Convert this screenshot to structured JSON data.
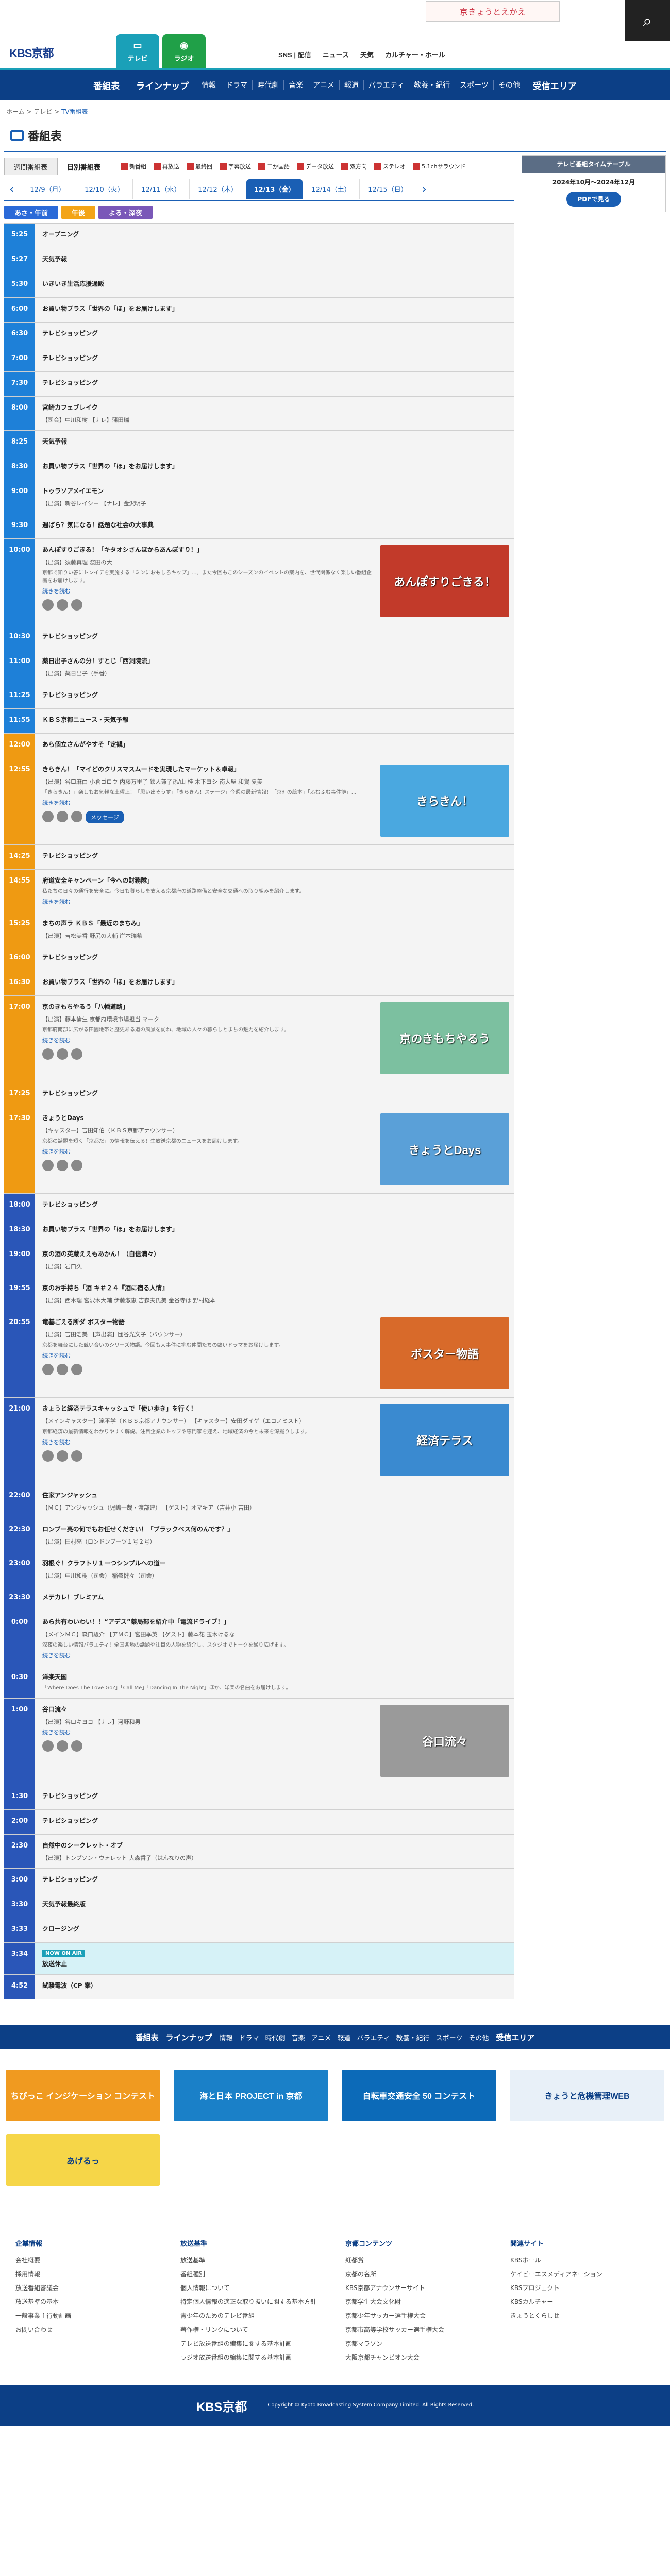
{
  "header": {
    "logo": "KBS京都",
    "media_tabs": [
      {
        "label": "テレビ"
      },
      {
        "label": "ラジオ"
      }
    ],
    "top_links": [
      "SNS | 配信",
      "ニュース",
      "天気",
      "カルチャー・ホール"
    ],
    "banner": "京きょうとえかえ"
  },
  "gnav": {
    "primary": [
      "番組表",
      "ラインナップ"
    ],
    "genres": [
      "情報",
      "ドラマ",
      "時代劇",
      "音楽",
      "アニメ",
      "報道",
      "バラエティ",
      "教養・紀行",
      "スポーツ",
      "その他"
    ],
    "area": "受信エリア"
  },
  "breadcrumb": {
    "home": "ホーム",
    "sep1": ">",
    "mid": "テレビ",
    "sep2": ">",
    "current": "TV番組表"
  },
  "page_title": "番組表",
  "view_tabs": [
    {
      "label": "週間番組表"
    },
    {
      "label": "日別番組表"
    }
  ],
  "legend": [
    "新番組",
    "再放送",
    "最終回",
    "字幕放送",
    "二か国語",
    "データ放送",
    "双方向",
    "ステレオ",
    "5.1chサラウンド"
  ],
  "dates": [
    "12/9（月）",
    "12/10（火）",
    "12/11（水）",
    "12/12（木）",
    "12/13（金）",
    "12/14（土）",
    "12/15（日）"
  ],
  "slot_tabs": [
    "あさ・午前",
    "午後",
    "よる・深夜"
  ],
  "programs": [
    {
      "time": "5:25",
      "title": "オープニング",
      "band": "am"
    },
    {
      "time": "5:27",
      "title": "天気予報",
      "band": "am"
    },
    {
      "time": "5:30",
      "title": "いきいき生活応援通販",
      "band": "am"
    },
    {
      "time": "6:00",
      "title": "お買い物プラス「世界の「ほ」をお届けします」",
      "band": "am"
    },
    {
      "time": "6:30",
      "title": "テレビショッピング",
      "band": "am"
    },
    {
      "time": "7:00",
      "title": "テレビショッピング",
      "band": "am"
    },
    {
      "time": "7:30",
      "title": "テレビショッピング",
      "band": "am"
    },
    {
      "time": "8:00",
      "title": "宮崎カフェブレイク",
      "cast": "【司会】中川和樹 【ナレ】蒲田瑞",
      "band": "am"
    },
    {
      "time": "8:25",
      "title": "天気予報",
      "band": "am"
    },
    {
      "time": "8:30",
      "title": "お買い物プラス「世界の「ほ」をお届けします」",
      "band": "am"
    },
    {
      "time": "9:00",
      "title": "トゥラソアメイエモン",
      "cast": "【出演】新谷レイシー 【ナレ】金沢明子",
      "band": "am"
    },
    {
      "time": "9:30",
      "title": "週ばら？気になる！話題な社会の大事典",
      "band": "am"
    },
    {
      "time": "10:00",
      "title": "あんぽすりごきる！「キタオシさんほからあんぽすり！」",
      "cast": "【出演】須藤真理 濱田の大",
      "desc": "京都で知りい答にトンイデを実施する「ミンにおもしろキップ」...。また今回もこのシーズンのイベントの案内を、世代関係なく楽しい番組企画をお届けします。",
      "more": "続きを読む",
      "thumb": "あんぽすりごきる！",
      "thumb_color": "#c23a2a",
      "band": "am",
      "big": true
    },
    {
      "time": "10:30",
      "title": "テレビショッピング",
      "band": "am"
    },
    {
      "time": "11:00",
      "title": "薬日出子さんの分！すとじ「西洞院流」",
      "cast": "【出演】薬日出子（手番）",
      "band": "am"
    },
    {
      "time": "11:25",
      "title": "テレビショッピング",
      "band": "am"
    },
    {
      "time": "11:55",
      "title": "ＫＢＳ京都ニュース・天気予報",
      "band": "am"
    },
    {
      "time": "12:00",
      "title": "あら個立さんがやすそ「定観」",
      "band": "pm"
    },
    {
      "time": "12:55",
      "title": "きらきん！「マイどのクリスマスムードを実現したマーケット＆卓報」",
      "cast": "【出演】谷口麻由 小倉ゴロウ 内藤万里子 鉄人兼子孫/山 桂 木下ヨシ 南大聖 和賀 夏美",
      "desc": "「きらきん！」楽しもお気軽な土曜上！「思い出そうす」「きらきん！ステージ」今週の最新情報！「京町の絵本」「ふむふむ事件簿」...",
      "more": "続きを読む",
      "msg": "メッセージ",
      "thumb": "きらきん！",
      "thumb_color": "#4aa8e0",
      "band": "pm",
      "big": true
    },
    {
      "time": "14:25",
      "title": "テレビショッピング",
      "band": "pm"
    },
    {
      "time": "14:55",
      "title": "府道安全キャンペーン「今への財務隊」",
      "desc": "私たちの日々の通行を安全に。今日も暮らしを支える京都府の道路整備と安全な交通への取り組みを紹介します。",
      "more": "続きを読む",
      "band": "pm"
    },
    {
      "time": "15:25",
      "title": "まちの声ラ ＫＢＳ「最近のまちみ」",
      "cast": "【出演】吉松美香 野尻の大輔 岸本瑞希",
      "band": "pm"
    },
    {
      "time": "16:00",
      "title": "テレビショッピング",
      "band": "pm"
    },
    {
      "time": "16:30",
      "title": "お買い物プラス「世界の「ほ」をお届けします」",
      "band": "pm"
    },
    {
      "time": "17:00",
      "title": "京のきもちやるう「八幡道路」",
      "cast": "【出演】藤本倫生 京都府環境市場担当 マーク",
      "desc": "京都府南部に広がる田園地帯と歴史ある道の風景を訪ね、地域の人々の暮らしとまちの魅力を紹介します。",
      "more": "続きを読む",
      "thumb": "京のきもちやるう",
      "thumb_color": "#7cc0a0",
      "band": "pm",
      "big": true
    },
    {
      "time": "17:25",
      "title": "テレビショッピング",
      "band": "pm"
    },
    {
      "time": "17:30",
      "title": "きょうとDays",
      "cast": "【キャスター】吉田知伯（ＫＢＳ京都アナウンサー）",
      "desc": "京都の話題を短く「京都だ」の情報を伝える！生放送京都のニュースをお届けします。",
      "more": "続きを読む",
      "thumb": "きょうとDays",
      "thumb_color": "#5aa0d8",
      "band": "pm",
      "big": true
    },
    {
      "time": "18:00",
      "title": "テレビショッピング",
      "band": "nt"
    },
    {
      "time": "18:30",
      "title": "お買い物プラス「世界の「ほ」をお届けします」",
      "band": "nt"
    },
    {
      "time": "19:00",
      "title": "京の酒の英蔵ええもあかん！（自信満々）",
      "cast": "【出演】岩口久",
      "band": "nt"
    },
    {
      "time": "19:55",
      "title": "京のお手持ち「酒 キ＃２４『酒に宿る人情』",
      "cast": "【出演】西木瑞 宮沢木大輔 伊藤淑恵 吉森夫氏美 金谷寺は 野村経本",
      "band": "nt"
    },
    {
      "time": "20:55",
      "title": "竜基ごえる所ダ ボスター物語",
      "cast": "【出演】吉田浩美 【声出演】団谷光文子（バウンサー）",
      "desc": "京都を舞台にした競い合いのシリーズ物語。今回も大事件に挑む仲間たちの熱いドラマをお届けします。",
      "more": "続きを読む",
      "thumb": "ボスター物語",
      "thumb_color": "#d86a2a",
      "band": "nt",
      "big": true
    },
    {
      "time": "21:00",
      "title": "きょうと経済テラスキャッシュで「使い歩き」を行く！",
      "cast": "【メインキャスター】滝平学（ＫＢＳ京都アナウンサー） 【キャスター】安田ダイゲ（エコノミスト）",
      "desc": "京都経済の最新情報をわかりやすく解説。注目企業のトップや専門家を迎え、地域経済の今と未来を深掘りします。",
      "more": "続きを読む",
      "thumb": "経済テラス",
      "thumb_color": "#3a8ad0",
      "band": "nt",
      "big": true
    },
    {
      "time": "22:00",
      "title": "住家アンジャッシュ",
      "cast": "【ＭＣ】アンジャッシュ（児嶋一哉・渡部建） 【ゲスト】オマキア（吉井小 吉田）",
      "band": "nt"
    },
    {
      "time": "22:30",
      "title": "ロンブー亮の何でもお任せください！「ブラックベス何のんです？」",
      "cast": "【出演】田村亮（ロンドンブーツ１号２号）",
      "band": "nt"
    },
    {
      "time": "23:00",
      "title": "羽根ぐ！クラフトリ１ーつシンプルへの道ー",
      "cast": "【出演】中川和樹（司会） 稲盛健々（司会）",
      "band": "nt"
    },
    {
      "time": "23:30",
      "title": "メテカレ！ブレミアム",
      "band": "nt"
    },
    {
      "time": "0:00",
      "title": "あら共有わいわい！！“アデス”薬局部を紹介中「電流ドライブ！」",
      "cast": "【メインＭＣ】森口駿介 【アＭＣ】宮田季英 【ゲスト】藤本花 玉木けるな",
      "desc": "深夜の楽しい情報バラエティ！全国各地の話題や注目の人物を紹介し、スタジオでトークを繰り広げます。",
      "more": "続きを読む",
      "band": "nt"
    },
    {
      "time": "0:30",
      "title": "洋楽天国",
      "desc": "「Where Does The Love Go?」「Call Me」「Dancing In The Night」ほか、洋楽の名曲をお届けします。",
      "band": "nt"
    },
    {
      "time": "1:00",
      "title": "谷口流々",
      "cast": "【出演】谷口キヨコ 【ナレ】河野和男",
      "more": "続きを読む",
      "thumb": "谷口流々",
      "thumb_color": "#9a9a9a",
      "band": "nt",
      "big": true
    },
    {
      "time": "1:30",
      "title": "テレビショッピング",
      "band": "nt"
    },
    {
      "time": "2:00",
      "title": "テレビショッピング",
      "band": "nt"
    },
    {
      "time": "2:30",
      "title": "自然中のシークレット・オブ",
      "cast": "【出演】トンプソン・ウォレット 大森香子（はんなりの声）",
      "band": "nt"
    },
    {
      "time": "3:00",
      "title": "テレビショッピング",
      "band": "nt"
    },
    {
      "time": "3:30",
      "title": "天気予報最終版",
      "band": "nt"
    },
    {
      "time": "3:33",
      "title": "クロージング",
      "band": "nt"
    },
    {
      "time": "3:34",
      "title": "放送休止",
      "band": "nt",
      "onair": "NOW ON AIR"
    },
    {
      "time": "4:52",
      "title": "試験電波（CP 案）",
      "band": "nt"
    }
  ],
  "sidebar": {
    "title": "テレビ番組タイムテーブル",
    "period": "2024年10月～2024年12月",
    "button": "PDFで見る"
  },
  "banners": [
    {
      "label": "ちびっこ インジケーション コンテスト",
      "color": "#f09a20"
    },
    {
      "label": "海と日本 PROJECT in 京都",
      "color": "#1a80c8"
    },
    {
      "label": "自転車交通安全 50 コンテスト",
      "color": "#0c6ab8"
    },
    {
      "label": "きょうと危機管理WEB",
      "color": "#e8f0f8"
    },
    {
      "label": "あげるっ",
      "color": "#f6d648"
    }
  ],
  "footer": {
    "cols": [
      {
        "title": "企業情報",
        "items": [
          "会社概要",
          "採用情報",
          "放送番組審議会",
          "放送基準の基本",
          "一般事業主行動計画",
          "お問い合わせ"
        ]
      },
      {
        "title": "放送基準",
        "items": [
          "放送基準",
          "番組種別",
          "個人情報について",
          "特定個人情報の適正な取り扱いに関する基本方針",
          "青少年のためのテレビ番組",
          "著作権・リンクについて",
          "テレビ放送番組の編集に関する基本計画",
          "ラジオ放送番組の編集に関する基本計画"
        ]
      },
      {
        "title": "京都コンテンツ",
        "items": [
          "紅都賞",
          "京都の名所",
          "KBS京都アナウンサーサイト",
          "京都学生大会文化財",
          "京都少年サッカー選手権大会",
          "京都市高等学校サッカー選手権大会",
          "京都マラソン",
          "大阪京都チャンピオン大会"
        ]
      },
      {
        "title": "関連サイト",
        "items": [
          "KBSホール",
          "ケイビーエスメディアネーション",
          "KBSプロジェクト",
          "KBSカルチャー",
          "きょうとくらしせ"
        ]
      }
    ],
    "logo": "KBS京都",
    "copyright": "Copyright © Kyoto Broadcasting System Company Limited. All Rights Reserved."
  }
}
